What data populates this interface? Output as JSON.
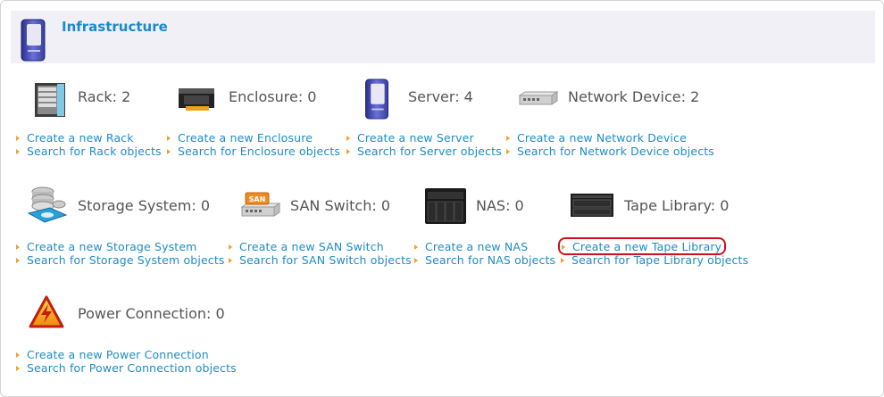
{
  "header": {
    "title": "Infrastructure",
    "icon": "server-icon"
  },
  "classes": [
    {
      "label": "Rack: 2",
      "create": "Create a new Rack",
      "search": "Search for Rack objects",
      "icon": "rack-icon"
    },
    {
      "label": "Enclosure: 0",
      "create": "Create a new Enclosure",
      "search": "Search for Enclosure objects",
      "icon": "enclosure-icon"
    },
    {
      "label": "Server: 4",
      "create": "Create a new Server",
      "search": "Search for Server objects",
      "icon": "server-icon"
    },
    {
      "label": "Network Device: 2",
      "create": "Create a new Network Device",
      "search": "Search for Network Device objects",
      "icon": "network-device-icon"
    },
    {
      "label": "Storage System: 0",
      "create": "Create a new Storage System",
      "search": "Search for Storage System objects",
      "icon": "storage-system-icon"
    },
    {
      "label": "SAN Switch: 0",
      "create": "Create a new SAN Switch",
      "search": "Search for SAN Switch objects",
      "icon": "san-switch-icon",
      "icon_text": "SAN"
    },
    {
      "label": "NAS: 0",
      "create": "Create a new NAS",
      "search": "Search for NAS objects",
      "icon": "nas-icon"
    },
    {
      "label": "Tape Library: 0",
      "create": "Create a new Tape Library",
      "search": "Search for Tape Library objects",
      "icon": "tape-library-icon",
      "create_highlighted": true
    },
    {
      "label": "Power Connection: 0",
      "create": "Create a new Power Connection",
      "search": "Search for Power Connection objects",
      "icon": "power-connection-icon"
    }
  ]
}
